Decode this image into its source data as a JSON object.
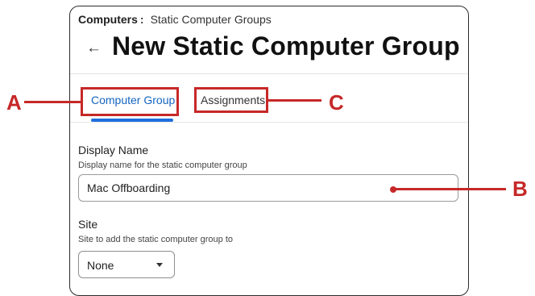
{
  "breadcrumb": {
    "root": "Computers",
    "separator": ":",
    "current": "Static Computer Groups"
  },
  "header": {
    "back_icon": "arrow-left-icon",
    "title": "New Static Computer Group"
  },
  "tabs": [
    {
      "label": "Computer Group",
      "active": true
    },
    {
      "label": "Assignments",
      "active": false
    }
  ],
  "form": {
    "display_name": {
      "label": "Display Name",
      "help": "Display name for the static computer group",
      "value": "Mac Offboarding"
    },
    "site": {
      "label": "Site",
      "help": "Site to add the static computer group to",
      "value": "None"
    }
  },
  "callouts": {
    "a": "A",
    "b": "B",
    "c": "C"
  },
  "colors": {
    "accent": "#1e6fe0",
    "callout": "#c62828"
  }
}
